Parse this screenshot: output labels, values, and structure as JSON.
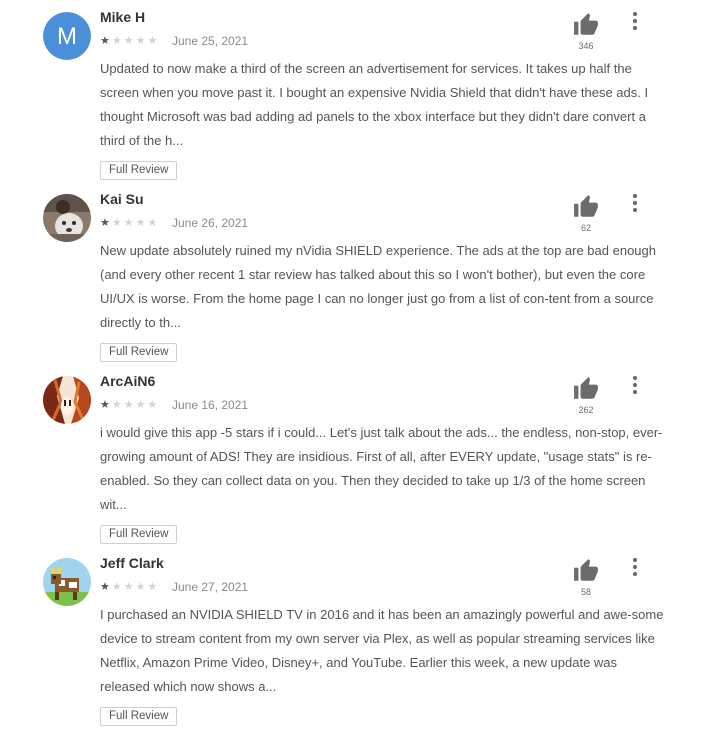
{
  "reviews": [
    {
      "author": "Mike H",
      "avatar_letter": "M",
      "avatar_color": "#4a90d9",
      "rating": 1,
      "date": "June 25, 2021",
      "helpful_count": "346",
      "text": "Updated to now make a third of the screen an advertisement for services. It takes up half the screen when you move past it. I bought an expensive Nvidia Shield that didn't have these ads. I thought Microsoft was bad adding ad panels to the xbox interface but they didn't dare convert a third of the h...",
      "full_review_label": "Full Review"
    },
    {
      "author": "Kai Su",
      "rating": 1,
      "date": "June 26, 2021",
      "helpful_count": "62",
      "text": "New update absolutely ruined my nVidia SHIELD experience. The ads at the top are bad enough (and every other recent 1 star review has talked about this so I won't bother), but even the core UI/UX is worse. From the home page I can no longer just go from a list of con-tent from a source directly to th...",
      "full_review_label": "Full Review"
    },
    {
      "author": "ArcAiN6",
      "rating": 1,
      "date": "June 16, 2021",
      "helpful_count": "262",
      "text": "i would give this app -5 stars if i could... Let's just talk about the ads... the endless, non-stop, ever-growing amount of ADS! They are insidious. First of all, after EVERY update, \"usage stats\" is re-enabled. So they can collect data on you. Then they decided to take up 1/3 of the home screen wit...",
      "full_review_label": "Full Review"
    },
    {
      "author": "Jeff Clark",
      "rating": 1,
      "date": "June 27, 2021",
      "helpful_count": "58",
      "text": "I purchased an NVIDIA SHIELD TV in 2016 and it has been an amazingly powerful and awe-some device to stream content from my own server via Plex, as well as popular streaming services like Netflix, Amazon Prime Video, Disney+, and YouTube. Earlier this week, a new update was released which now shows a...",
      "full_review_label": "Full Review"
    }
  ]
}
